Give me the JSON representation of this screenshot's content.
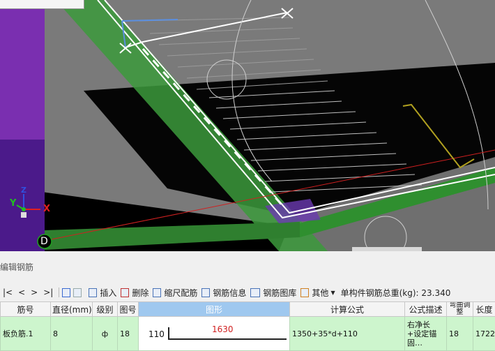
{
  "viewport": {
    "axes": {
      "x_label": "X",
      "y_label": "Y",
      "z_label": "Z"
    },
    "view_badge": "D"
  },
  "panel": {
    "title": "编辑钢筋",
    "toolbar": {
      "nav": [
        "|<",
        "<",
        ">",
        ">|"
      ],
      "insert": "插入",
      "delete": "删除",
      "scale": "缩尺配筋",
      "info": "钢筋信息",
      "library": "钢筋图库",
      "other": "其他",
      "total_label": "单构件钢筋总重(kg): 23.340"
    },
    "table": {
      "headers": [
        "筋号",
        "直径(mm)",
        "级别",
        "图号",
        "图形",
        "计算公式",
        "公式描述",
        "弯曲调整",
        "长度"
      ],
      "rows": [
        {
          "name": "板负筋.1",
          "diameter": "8",
          "grade": "ф",
          "fig_no": "18",
          "shape_left": "110",
          "shape_top": "1630",
          "formula": "1350+35*d+110",
          "desc": "右净长+设定锚固…",
          "bend": "18",
          "length": "1722"
        }
      ]
    }
  }
}
